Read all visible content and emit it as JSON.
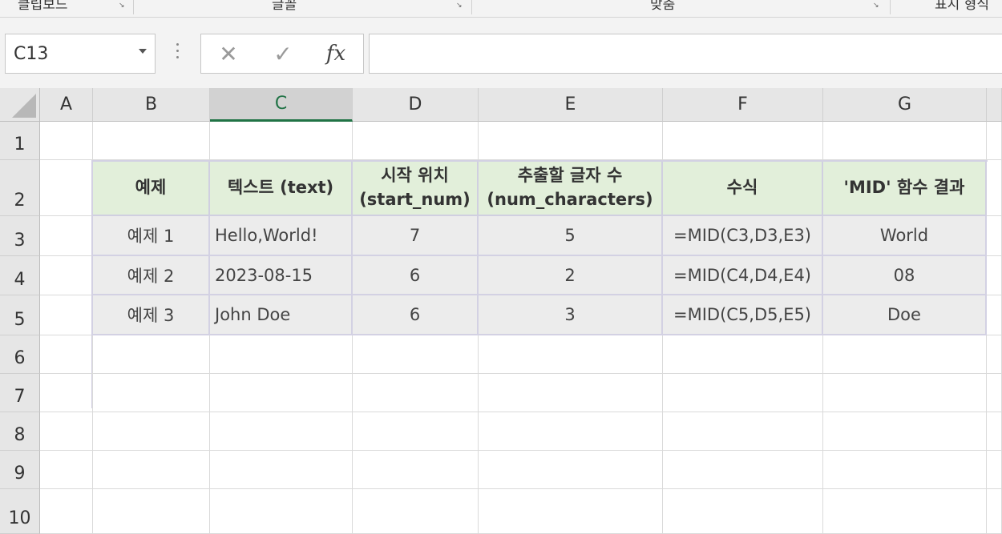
{
  "ribbon": {
    "groups": [
      {
        "label": "클립보드"
      },
      {
        "label": "글꼴"
      },
      {
        "label": "맞춤"
      },
      {
        "label": "표시 형식"
      }
    ]
  },
  "formula_bar": {
    "name_box": "C13",
    "cancel_icon": "✕",
    "enter_icon": "✓",
    "fx_label": "fx",
    "formula": ""
  },
  "grid": {
    "columns": [
      "A",
      "B",
      "C",
      "D",
      "E",
      "F",
      "G"
    ],
    "selected_column": "C",
    "rows": [
      "1",
      "2",
      "3",
      "4",
      "5",
      "6",
      "7",
      "8",
      "9",
      "10"
    ],
    "table": {
      "headers": [
        "예제",
        "텍스트 (text)",
        "시작 위치 (start_num)",
        "추출할 글자 수 (num_characters)",
        "수식",
        "'MID' 함수 결과"
      ],
      "rows": [
        [
          "예제 1",
          "Hello,World!",
          "7",
          "5",
          "=MID(C3,D3,E3)",
          "World"
        ],
        [
          "예제 2",
          "2023-08-15",
          "6",
          "2",
          "=MID(C4,D4,E4)",
          "08"
        ],
        [
          "예제 3",
          "John Doe",
          "6",
          "3",
          "=MID(C5,D5,E5)",
          "Doe"
        ]
      ]
    }
  },
  "colors": {
    "header_fill": "#e2efda",
    "data_fill": "#ececec",
    "accent": "#217346"
  }
}
